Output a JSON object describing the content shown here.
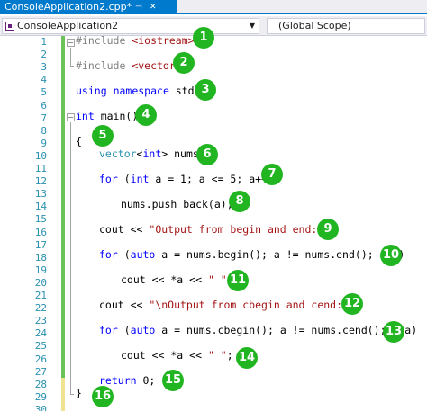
{
  "tab": {
    "title": "ConsoleApplication2.cpp*",
    "pin_icon": "⊣",
    "close_icon": "✕"
  },
  "navbar": {
    "project": "ConsoleApplication2",
    "scope": "(Global Scope)"
  },
  "line_numbers": [
    "1",
    "2",
    "3",
    "4",
    "5",
    "6",
    "7",
    "8",
    "9",
    "10",
    "11",
    "12",
    "13",
    "14",
    "15",
    "16",
    "17",
    "18",
    "19",
    "20",
    "21",
    "22",
    "23",
    "24",
    "25",
    "26",
    "27",
    "28",
    "29",
    "30"
  ],
  "code": {
    "include_iostream": {
      "directive": "#include ",
      "header": "<iostream>"
    },
    "include_vector": {
      "directive": "#include ",
      "header": "<vector>"
    },
    "using": {
      "kw1": "using",
      "kw2": "namespace",
      "rest": " std;"
    },
    "main": {
      "kw": "int",
      "rest": " main()"
    },
    "open_brace": "{",
    "vector_decl": {
      "type": "vector",
      "lt": "<",
      "kw": "int",
      "rest": "> nums;"
    },
    "for1": {
      "kw1": "for",
      "a": " (",
      "kw2": "int",
      "b": " a = 1; a <= 5; a++)"
    },
    "push_back": "nums.push_back(a);",
    "cout1": {
      "a": "cout << ",
      "str": "\"Output from begin and end: \"",
      "b": ";"
    },
    "for2": {
      "kw1": "for",
      "a": " (",
      "kw2": "auto",
      "b": " a = nums.begin(); a != nums.end(); ++a)"
    },
    "cout2": {
      "a": "cout << *a << ",
      "str": "\" \"",
      "b": ";"
    },
    "cout3": {
      "a": "cout << ",
      "str": "\"\\nOutput from cbegin and cend: \"",
      "b": ";"
    },
    "for3": {
      "kw1": "for",
      "a": " (",
      "kw2": "auto",
      "b": " a = nums.cbegin(); a != nums.cend(); ++a)"
    },
    "cout4": {
      "a": "cout << *a << ",
      "str": "\" \"",
      "b": ";"
    },
    "ret": {
      "kw": "return",
      "rest": " 0;"
    },
    "close_brace": "}"
  },
  "badges": [
    "1",
    "2",
    "3",
    "4",
    "5",
    "6",
    "7",
    "8",
    "9",
    "10",
    "11",
    "12",
    "13",
    "14",
    "15",
    "16"
  ],
  "colors": {
    "accent": "#007acc",
    "badge": "#22b522",
    "keyword": "#0000ff",
    "string": "#a31515",
    "type": "#2b91af",
    "preprocessor": "#808080",
    "line_number": "#2b91af",
    "change_saved": "#6ac259",
    "change_unsaved": "#efe38f"
  }
}
